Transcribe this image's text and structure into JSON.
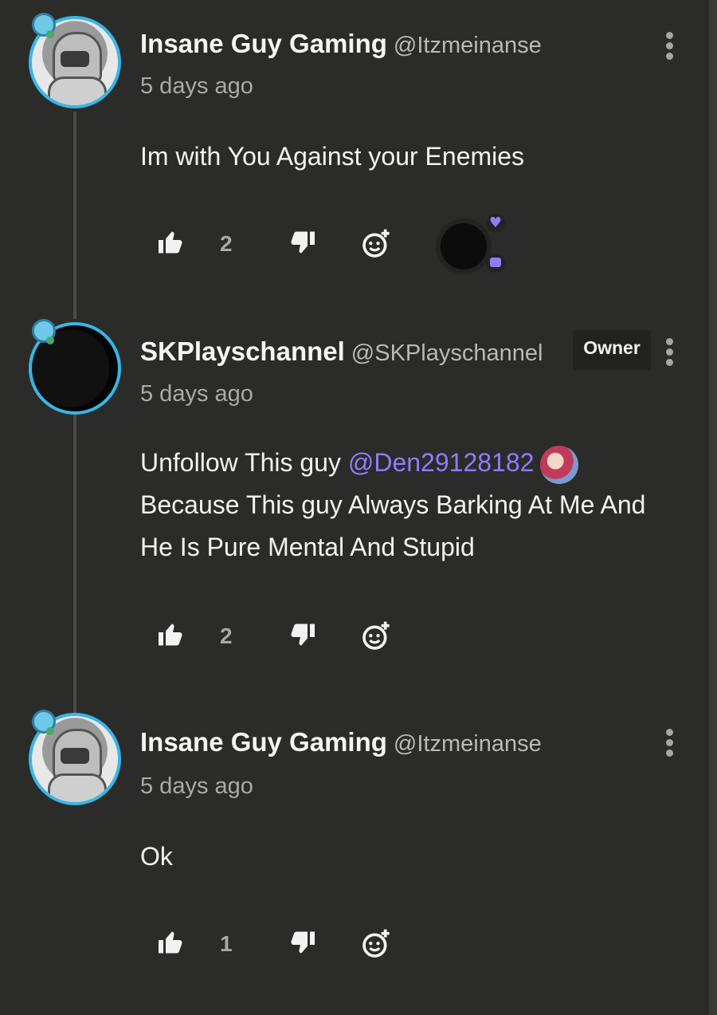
{
  "comments": [
    {
      "author": "Insane Guy Gaming",
      "handle": "@Itzmeinanse",
      "timestamp": "5 days ago",
      "text": "Im with You Against your Enemies",
      "likes": "2"
    },
    {
      "author": "SKPlayschannel",
      "handle": "@SKPlayschannel",
      "timestamp": "5 days ago",
      "badge": "Owner",
      "text_before": "Unfollow This guy ",
      "mention": "@Den29128182",
      "text_after": "Because This guy Always Barking At Me And He Is Pure Mental And Stupid",
      "likes": "2"
    },
    {
      "author": "Insane Guy Gaming",
      "handle": "@Itzmeinanse",
      "timestamp": "5 days ago",
      "text": "Ok",
      "likes": "1"
    }
  ],
  "icons": {
    "like": "thumbs-up-icon",
    "dislike": "thumbs-down-icon",
    "react": "emoji-add-icon",
    "more": "more-vertical-icon"
  },
  "colors": {
    "background": "#2b2b29",
    "avatar_ring": "#38b6e6",
    "mention": "#8f7cff",
    "muted": "#a9a9a9"
  }
}
